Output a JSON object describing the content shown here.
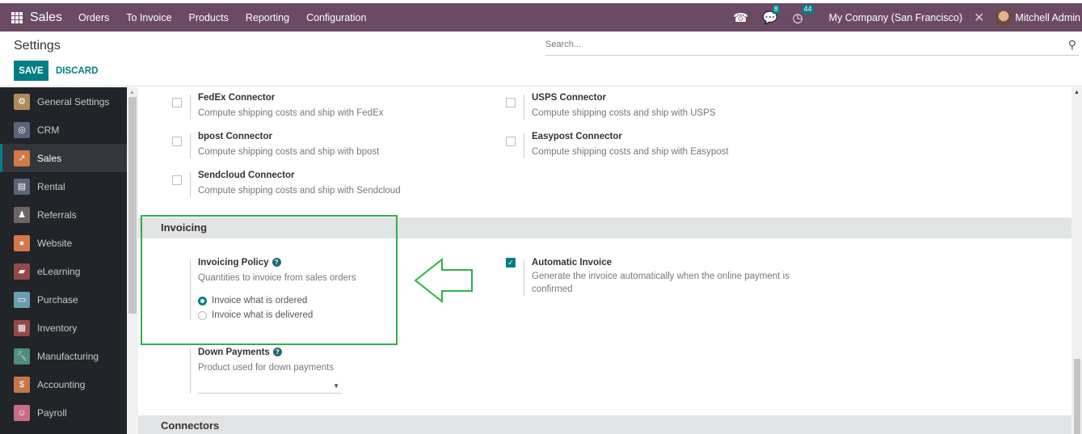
{
  "topbar": {
    "app_name": "Sales",
    "menus": [
      "Orders",
      "To Invoice",
      "Products",
      "Reporting",
      "Configuration"
    ],
    "messages_badge": "8",
    "activities_badge": "44",
    "company": "My Company (San Francisco)",
    "user": "Mitchell Admin",
    "bg_color": "#6b4a64"
  },
  "control_panel": {
    "title": "Settings",
    "save_label": "SAVE",
    "discard_label": "DISCARD",
    "search_placeholder": "Search..."
  },
  "sidebar": {
    "items": [
      {
        "label": "General Settings",
        "icon": "gear-icon",
        "color": "#b08b59",
        "active": false
      },
      {
        "label": "CRM",
        "icon": "handshake-icon",
        "color": "#5b6378",
        "active": false
      },
      {
        "label": "Sales",
        "icon": "chart-icon",
        "color": "#d07a47",
        "active": true
      },
      {
        "label": "Rental",
        "icon": "rental-icon",
        "color": "#5b6378",
        "active": false
      },
      {
        "label": "Referrals",
        "icon": "referrals-icon",
        "color": "#6d6468",
        "active": false
      },
      {
        "label": "Website",
        "icon": "globe-icon",
        "color": "#d5784a",
        "active": false
      },
      {
        "label": "eLearning",
        "icon": "elearning-icon",
        "color": "#924a4a",
        "active": false
      },
      {
        "label": "Purchase",
        "icon": "card-icon",
        "color": "#6a9eb0",
        "active": false
      },
      {
        "label": "Inventory",
        "icon": "box-icon",
        "color": "#944a4a",
        "active": false
      },
      {
        "label": "Manufacturing",
        "icon": "wrench-icon",
        "color": "#4e8f7b",
        "active": false
      },
      {
        "label": "Accounting",
        "icon": "invoice-icon",
        "color": "#c7764a",
        "active": false
      },
      {
        "label": "Payroll",
        "icon": "payroll-icon",
        "color": "#c86c87",
        "active": false
      }
    ]
  },
  "shipping": {
    "fedex": {
      "title": "FedEx Connector",
      "desc": "Compute shipping costs and ship with FedEx",
      "checked": false
    },
    "usps": {
      "title": "USPS Connector",
      "desc": "Compute shipping costs and ship with USPS",
      "checked": false
    },
    "bpost": {
      "title": "bpost Connector",
      "desc": "Compute shipping costs and ship with bpost",
      "checked": false
    },
    "easypost": {
      "title": "Easypost Connector",
      "desc": "Compute shipping costs and ship with Easypost",
      "checked": false
    },
    "sendcloud": {
      "title": "Sendcloud Connector",
      "desc": "Compute shipping costs and ship with Sendcloud",
      "checked": false
    }
  },
  "invoicing": {
    "section_title": "Invoicing",
    "policy": {
      "title": "Invoicing Policy",
      "desc": "Quantities to invoice from sales orders",
      "options": [
        "Invoice what is ordered",
        "Invoice what is delivered"
      ],
      "selected": "Invoice what is ordered"
    },
    "automatic_invoice": {
      "title": "Automatic Invoice",
      "desc": "Generate the invoice automatically when the online payment is confirmed",
      "checked": true
    },
    "down_payments": {
      "title": "Down Payments",
      "desc": "Product used for down payments",
      "value": ""
    }
  },
  "connectors_section": {
    "title": "Connectors"
  },
  "annotation": {
    "color": "#2fb04f"
  }
}
